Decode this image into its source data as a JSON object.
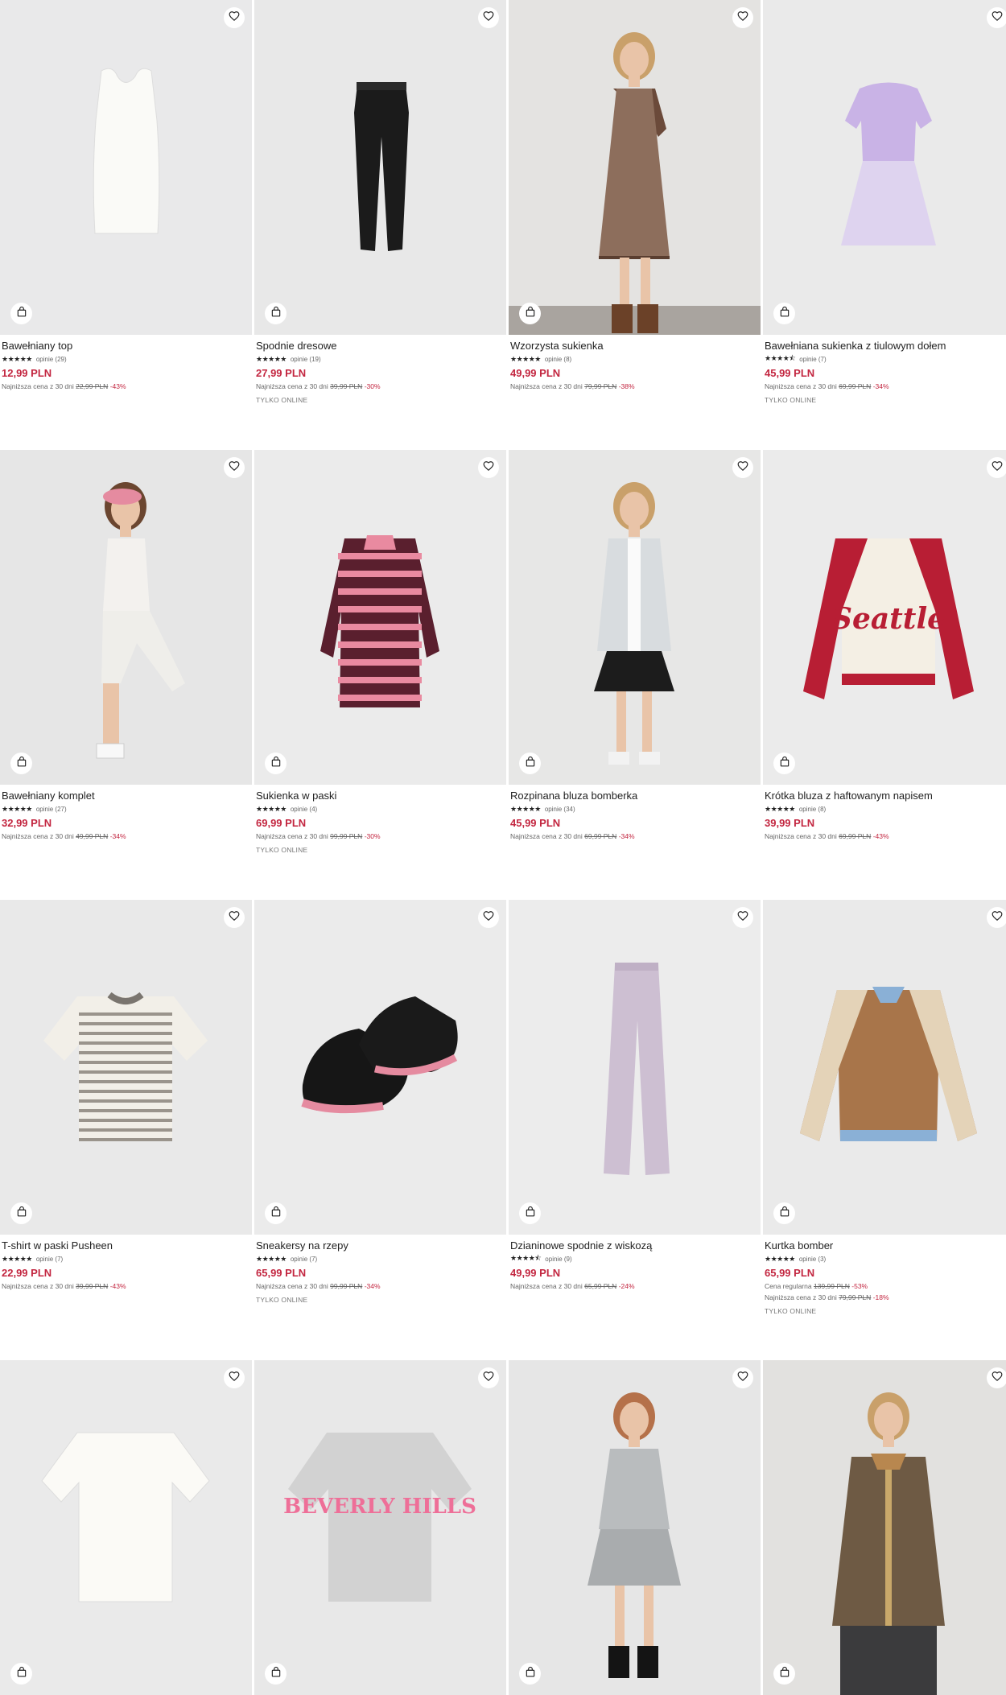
{
  "products": [
    {
      "name": "Bawełniany top",
      "stars": "★★★★★",
      "reviews": "opinie (29)",
      "price": "12,99 PLN",
      "lowest_label": "Najniższa cena z 30 dni",
      "old_price": "22,99 PLN",
      "discount": "-43%",
      "online": "",
      "regular": null,
      "bg": "#e9e9ea",
      "art": "tank"
    },
    {
      "name": "Spodnie dresowe",
      "stars": "★★★★★",
      "reviews": "opinie (19)",
      "price": "27,99 PLN",
      "lowest_label": "Najniższa cena z 30 dni",
      "old_price": "39,99 PLN",
      "discount": "-30%",
      "online": "TYLKO ONLINE",
      "regular": null,
      "bg": "#e8e8e8",
      "art": "pants-black"
    },
    {
      "name": "Wzorzysta sukienka",
      "stars": "★★★★★",
      "reviews": "opinie (8)",
      "price": "49,99 PLN",
      "lowest_label": "Najniższa cena z 30 dni",
      "old_price": "79,99 PLN",
      "discount": "-38%",
      "online": "",
      "regular": null,
      "bg": "#e4e3e1",
      "art": "girl-dress"
    },
    {
      "name": "Bawełniana sukienka z tiulowym dołem",
      "stars": "★★★★⯪",
      "reviews": "opinie (7)",
      "price": "45,99 PLN",
      "lowest_label": "Najniższa cena z 30 dni",
      "old_price": "69,99 PLN",
      "discount": "-34%",
      "online": "TYLKO ONLINE",
      "regular": null,
      "bg": "#eaeaea",
      "art": "tulle-dress"
    },
    {
      "name": "Bawełniany komplet",
      "stars": "★★★★★",
      "reviews": "opinie (27)",
      "price": "32,99 PLN",
      "lowest_label": "Najniższa cena z 30 dni",
      "old_price": "49,99 PLN",
      "discount": "-34%",
      "online": "",
      "regular": null,
      "bg": "#e6e6e6",
      "art": "girl-set"
    },
    {
      "name": "Sukienka w paski",
      "stars": "★★★★★",
      "reviews": "opinie (4)",
      "price": "69,99 PLN",
      "lowest_label": "Najniższa cena z 30 dni",
      "old_price": "99,99 PLN",
      "discount": "-30%",
      "online": "TYLKO ONLINE",
      "regular": null,
      "bg": "#ebebeb",
      "art": "striped-dress"
    },
    {
      "name": "Rozpinana bluza bomberka",
      "stars": "★★★★★",
      "reviews": "opinie (34)",
      "price": "45,99 PLN",
      "lowest_label": "Najniższa cena z 30 dni",
      "old_price": "69,99 PLN",
      "discount": "-34%",
      "online": "",
      "regular": null,
      "bg": "#e7e7e6",
      "art": "girl-bomber"
    },
    {
      "name": "Krótka bluza z haftowanym napisem",
      "stars": "★★★★★",
      "reviews": "opinie (8)",
      "price": "39,99 PLN",
      "lowest_label": "Najniższa cena z 30 dni",
      "old_price": "69,99 PLN",
      "discount": "-43%",
      "online": "",
      "regular": null,
      "bg": "#ebebeb",
      "art": "seattle"
    },
    {
      "name": "T-shirt w paski Pusheen",
      "stars": "★★★★★",
      "reviews": "opinie (7)",
      "price": "22,99 PLN",
      "lowest_label": "Najniższa cena z 30 dni",
      "old_price": "39,99 PLN",
      "discount": "-43%",
      "online": "",
      "regular": null,
      "bg": "#e9e9e9",
      "art": "tee-striped"
    },
    {
      "name": "Sneakersy na rzepy",
      "stars": "★★★★★",
      "reviews": "opinie (7)",
      "price": "65,99 PLN",
      "lowest_label": "Najniższa cena z 30 dni",
      "old_price": "99,99 PLN",
      "discount": "-34%",
      "online": "TYLKO ONLINE",
      "regular": null,
      "bg": "#ebebeb",
      "art": "sneakers"
    },
    {
      "name": "Dzianinowe spodnie z wiskozą",
      "stars": "★★★★⯪",
      "reviews": "opinie (9)",
      "price": "49,99 PLN",
      "lowest_label": "Najniższa cena z 30 dni",
      "old_price": "65,99 PLN",
      "discount": "-24%",
      "online": "",
      "regular": null,
      "bg": "#ececec",
      "art": "pants-lilac"
    },
    {
      "name": "Kurtka bomber",
      "stars": "★★★★★",
      "reviews": "opinie (3)",
      "price": "65,99 PLN",
      "lowest_label": "Najniższa cena z 30 dni",
      "old_price": "79,99 PLN",
      "discount": "-18%",
      "online": "TYLKO ONLINE",
      "regular": {
        "label": "Cena regularna",
        "old": "139,99 PLN",
        "discount": "-53%"
      },
      "bg": "#eaeaea",
      "art": "varsity"
    },
    {
      "name": "",
      "stars": "",
      "reviews": "",
      "price": "",
      "lowest_label": "",
      "old_price": "",
      "discount": "",
      "online": "",
      "regular": null,
      "bg": "#eaeaea",
      "art": "white-tee"
    },
    {
      "name": "",
      "stars": "",
      "reviews": "",
      "price": "",
      "lowest_label": "",
      "old_price": "",
      "discount": "",
      "online": "",
      "regular": null,
      "bg": "#e8e8e8",
      "art": "beverly"
    },
    {
      "name": "",
      "stars": "",
      "reviews": "",
      "price": "",
      "lowest_label": "",
      "old_price": "",
      "discount": "",
      "online": "",
      "regular": null,
      "bg": "#e6e6e6",
      "art": "girl-sweatdress"
    },
    {
      "name": "",
      "stars": "",
      "reviews": "",
      "price": "",
      "lowest_label": "",
      "old_price": "",
      "discount": "",
      "online": "",
      "regular": null,
      "bg": "#e2e1df",
      "art": "girl-jacket"
    }
  ],
  "art_text": {
    "seattle": "Seattle",
    "beverly": "BEVERLY HILLS"
  },
  "icons": {
    "favorite": "heart-icon",
    "cart": "shopping-bag-icon",
    "rating": "star-icon"
  },
  "colors": {
    "accent": "#c32640",
    "text": "#222222",
    "muted": "#666666"
  }
}
